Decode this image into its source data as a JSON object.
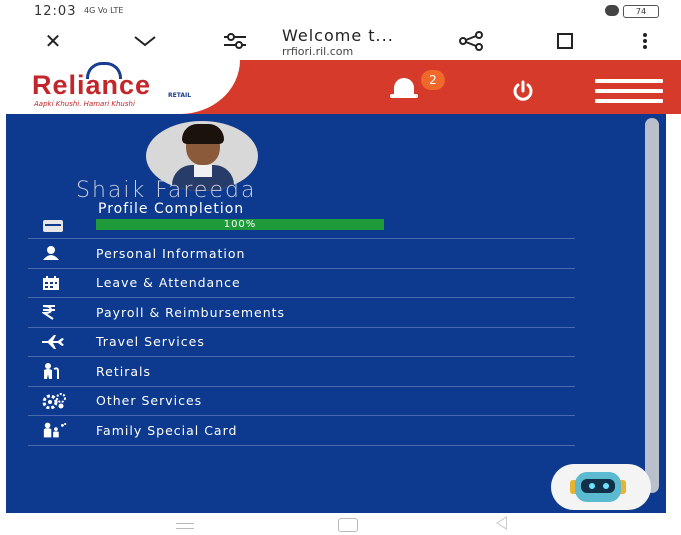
{
  "status_bar": {
    "time": "12:03",
    "signal": "4G Vo LTE",
    "battery": "74"
  },
  "browser": {
    "page_title": "Welcome t...",
    "url": "rrfiori.ril.com"
  },
  "header": {
    "logo_text": "Reliance",
    "logo_sub": "RETAIL",
    "logo_tagline": "Aapki Khushi. Hamari Khushi",
    "notification_count": "2"
  },
  "profile": {
    "name": "Shaik Fareeda",
    "completion_label": "Profile Completion",
    "completion_value": "100%",
    "completion_fraction": 1.0
  },
  "menu": [
    {
      "label": "Personal Information",
      "icon": "person-icon"
    },
    {
      "label": "Leave & Attendance",
      "icon": "calendar-icon"
    },
    {
      "label": "Payroll & Reimbursements",
      "icon": "rupee-icon"
    },
    {
      "label": "Travel Services",
      "icon": "airplane-icon"
    },
    {
      "label": "Retirals",
      "icon": "elderly-icon"
    },
    {
      "label": "Other Services",
      "icon": "gears-icon"
    },
    {
      "label": "Family Special Card",
      "icon": "family-icon"
    }
  ],
  "colors": {
    "header_red": "#d63a2a",
    "panel_blue": "#0d3a8e",
    "progress_green": "#1f9a3a",
    "badge_orange": "#f0682a"
  }
}
